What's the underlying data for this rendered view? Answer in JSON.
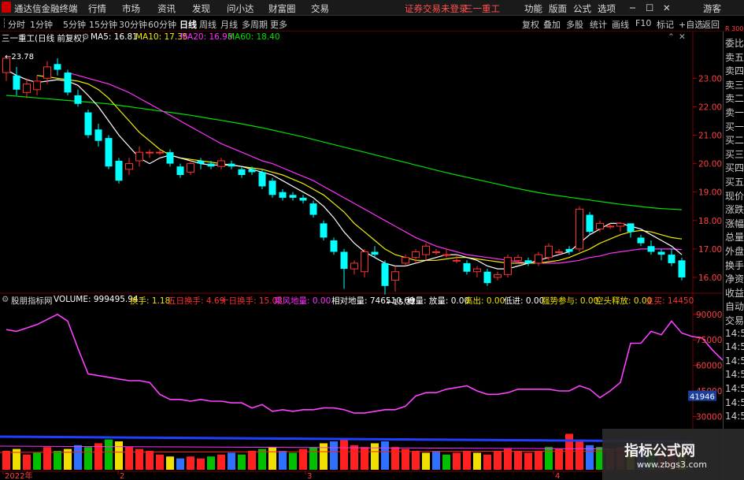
{
  "app": {
    "title": "通达信金融终端",
    "menus": [
      "行情",
      "市场",
      "资讯",
      "发现",
      "问小达",
      "财富圈",
      "交易"
    ],
    "login_notice": "证券交易未登录",
    "stock_title": "三一重工",
    "right_menus": [
      "功能",
      "版面",
      "公式",
      "选项"
    ],
    "guest": "游客"
  },
  "toolbar": {
    "periods": [
      "分时",
      "1分钟",
      "5分钟",
      "15分钟",
      "30分钟",
      "60分钟",
      "日线",
      "周线",
      "月线",
      "多周期",
      "更多"
    ],
    "active_period": "日线",
    "actions": [
      "复权",
      "叠加",
      "多股",
      "统计",
      "画线",
      "F10",
      "标记",
      "+自选",
      "返回"
    ]
  },
  "chart_header": {
    "name": "三一重工(日线 前复权)",
    "ma5": "MA5: 16.81",
    "ma10": "MA10: 17.35",
    "ma20": "MA20: 16.98",
    "ma60": "MA60: 18.40"
  },
  "indicator_header": {
    "name": "股朋指标网",
    "volume": "VOLUME: 999495.94",
    "items": [
      {
        "t": "换手: 1.18",
        "c": "#f0e000"
      },
      {
        "t": "五日换手: 4.69",
        "c": "#ff3030"
      },
      {
        "t": "十日换手: 15.03",
        "c": "#ff3030"
      },
      {
        "t": "乘风地量: 0.00",
        "c": "#ff30ff"
      },
      {
        "t": "相对地量: 746510.69",
        "c": "#ffffff"
      },
      {
        "t": "地量: 放量: 0.00",
        "c": "#ffffff"
      },
      {
        "t": "高出: 0.00",
        "c": "#f0e000"
      },
      {
        "t": "低进: 0.00",
        "c": "#ffffff"
      },
      {
        "t": "强势参与: 0.00",
        "c": "#f0e000"
      },
      {
        "t": "空头释放: 0.00",
        "c": "#f0e000"
      },
      {
        "t": "主买: 14450",
        "c": "#ff3030"
      }
    ]
  },
  "right_panel": [
    "委比",
    "卖五",
    "卖四",
    "卖三",
    "卖二",
    "卖一",
    "买一",
    "买二",
    "买三",
    "买四",
    "买五",
    "现价",
    "涨跌",
    "涨幅",
    "总量",
    "外盘",
    "换手",
    "净资",
    "收益",
    "自动",
    "交易",
    "14:56",
    "14:56",
    "14:56",
    "14:56",
    "14:56",
    "14:56",
    "14:56"
  ],
  "right_panel_top": "R 300",
  "watermark": {
    "main": "指标公式网",
    "sub": "www.zbgs3.com"
  },
  "chart_data": {
    "type": "candlestick",
    "price_axis": {
      "ticks": [
        "23.00",
        "22.00",
        "21.00",
        "20.00",
        "19.00",
        "18.00",
        "17.00",
        "16.00"
      ],
      "range": [
        15.5,
        24.2
      ]
    },
    "indicator_axis": {
      "ticks": [
        "90000",
        "75000",
        "60000",
        "45000",
        "30000"
      ],
      "current": "41946"
    },
    "x_labels": [
      "2022年",
      "2",
      "3",
      "4"
    ],
    "annotations": {
      "high": "23.78",
      "low": "15.37"
    },
    "colors": {
      "up": "#ff3030",
      "down": "#00ffff",
      "ma5": "#ffffff",
      "ma10": "#f0f000",
      "ma20": "#ff30ff",
      "ma60": "#00e000",
      "ind": "#ff40ff"
    },
    "candles": [
      [
        23.2,
        23.7,
        23.78,
        22.9
      ],
      [
        23.1,
        22.6,
        23.4,
        22.4
      ],
      [
        22.5,
        22.8,
        23.0,
        22.3
      ],
      [
        22.6,
        22.9,
        23.1,
        22.4
      ],
      [
        23.0,
        23.4,
        23.6,
        22.8
      ],
      [
        23.5,
        23.3,
        23.7,
        23.1
      ],
      [
        23.2,
        22.5,
        23.3,
        22.4
      ],
      [
        22.4,
        22.1,
        22.6,
        22.0
      ],
      [
        21.8,
        21.0,
        21.9,
        20.9
      ],
      [
        21.2,
        20.8,
        21.4,
        20.6
      ],
      [
        20.9,
        19.9,
        21.0,
        19.8
      ],
      [
        20.1,
        19.4,
        20.2,
        19.3
      ],
      [
        19.8,
        20.0,
        20.2,
        19.6
      ],
      [
        20.1,
        20.4,
        20.6,
        19.9
      ],
      [
        20.4,
        20.4,
        20.5,
        20.2
      ],
      [
        20.4,
        20.4,
        20.5,
        20.3
      ],
      [
        20.4,
        20.0,
        20.5,
        19.9
      ],
      [
        19.9,
        19.6,
        20.0,
        19.5
      ],
      [
        19.7,
        20.0,
        20.1,
        19.6
      ],
      [
        20.1,
        20.0,
        20.2,
        19.8
      ],
      [
        20.0,
        19.9,
        20.1,
        19.8
      ],
      [
        19.9,
        20.1,
        20.2,
        19.8
      ],
      [
        20.0,
        19.9,
        20.1,
        19.8
      ],
      [
        19.8,
        19.6,
        19.9,
        19.5
      ],
      [
        19.8,
        19.7,
        19.9,
        19.6
      ],
      [
        19.7,
        19.2,
        19.8,
        19.1
      ],
      [
        19.4,
        18.9,
        19.5,
        18.8
      ],
      [
        19.0,
        18.8,
        19.1,
        18.7
      ],
      [
        18.9,
        18.8,
        19.0,
        18.7
      ],
      [
        18.8,
        18.7,
        18.9,
        18.6
      ],
      [
        18.6,
        18.2,
        18.7,
        18.1
      ],
      [
        17.9,
        17.4,
        18.0,
        17.3
      ],
      [
        17.3,
        16.9,
        17.4,
        16.8
      ],
      [
        16.9,
        16.3,
        17.0,
        15.6
      ],
      [
        16.3,
        16.5,
        16.6,
        16.1
      ],
      [
        16.2,
        16.9,
        17.0,
        16.0
      ],
      [
        16.9,
        16.8,
        17.1,
        16.7
      ],
      [
        16.5,
        15.7,
        16.6,
        15.4
      ],
      [
        15.9,
        16.2,
        16.4,
        15.5
      ],
      [
        16.5,
        16.7,
        16.8,
        16.4
      ],
      [
        16.7,
        16.9,
        17.0,
        16.5
      ],
      [
        16.8,
        17.1,
        17.2,
        16.6
      ],
      [
        16.9,
        16.9,
        17.0,
        16.8
      ],
      [
        16.8,
        16.8,
        17.0,
        16.7
      ],
      [
        16.6,
        16.6,
        16.8,
        16.5
      ],
      [
        16.5,
        16.2,
        16.6,
        16.1
      ],
      [
        16.2,
        16.3,
        16.4,
        16.0
      ],
      [
        16.2,
        15.8,
        16.3,
        15.7
      ],
      [
        16.0,
        16.1,
        16.2,
        15.9
      ],
      [
        16.1,
        16.7,
        16.8,
        16.0
      ],
      [
        16.6,
        16.7,
        16.8,
        16.5
      ],
      [
        16.6,
        16.5,
        16.7,
        16.4
      ],
      [
        16.5,
        16.8,
        16.9,
        16.4
      ],
      [
        16.7,
        17.1,
        17.2,
        16.6
      ],
      [
        16.9,
        16.9,
        17.0,
        16.8
      ],
      [
        17.0,
        16.9,
        17.1,
        16.8
      ],
      [
        17.0,
        18.4,
        18.5,
        16.9
      ],
      [
        18.2,
        17.6,
        18.3,
        17.5
      ],
      [
        17.7,
        17.9,
        18.0,
        17.6
      ],
      [
        17.8,
        17.8,
        17.9,
        17.7
      ],
      [
        17.8,
        17.9,
        17.95,
        17.6
      ],
      [
        17.9,
        17.6,
        17.9,
        17.4
      ],
      [
        17.4,
        17.2,
        17.5,
        17.1
      ],
      [
        17.1,
        16.9,
        17.3,
        16.8
      ],
      [
        16.9,
        16.8,
        17.0,
        16.6
      ],
      [
        16.8,
        16.5,
        17.0,
        16.4
      ],
      [
        16.6,
        16.0,
        16.7,
        15.9
      ]
    ],
    "ma5": [
      23.3,
      23.1,
      22.95,
      22.85,
      22.9,
      22.95,
      22.9,
      22.75,
      22.4,
      22.0,
      21.5,
      21.0,
      20.6,
      20.2,
      20.0,
      20.2,
      20.3,
      20.2,
      20.1,
      20.0,
      19.95,
      19.95,
      19.95,
      19.9,
      19.8,
      19.7,
      19.6,
      19.4,
      19.2,
      19.0,
      18.8,
      18.5,
      18.1,
      17.6,
      17.2,
      16.9,
      16.7,
      16.5,
      16.4,
      16.4,
      16.5,
      16.6,
      16.7,
      16.8,
      16.8,
      16.7,
      16.6,
      16.4,
      16.3,
      16.3,
      16.4,
      16.5,
      16.6,
      16.7,
      16.8,
      16.9,
      17.2,
      17.5,
      17.7,
      17.9,
      17.9,
      17.8,
      17.7,
      17.5,
      17.3,
      17.1,
      16.8
    ],
    "ma10": [
      null,
      null,
      null,
      23.1,
      23.05,
      23.0,
      22.95,
      22.9,
      22.8,
      22.6,
      22.3,
      21.9,
      21.5,
      21.1,
      20.8,
      20.5,
      20.3,
      20.2,
      20.15,
      20.1,
      20.05,
      20.0,
      19.95,
      19.9,
      19.85,
      19.8,
      19.7,
      19.6,
      19.45,
      19.3,
      19.1,
      18.9,
      18.6,
      18.3,
      17.9,
      17.6,
      17.3,
      17.0,
      16.8,
      16.7,
      16.6,
      16.6,
      16.6,
      16.65,
      16.7,
      16.7,
      16.65,
      16.6,
      16.55,
      16.5,
      16.5,
      16.5,
      16.5,
      16.55,
      16.6,
      16.7,
      16.85,
      17.0,
      17.2,
      17.35,
      17.5,
      17.6,
      17.65,
      17.6,
      17.5,
      17.4,
      17.35
    ],
    "ma20": [
      null,
      null,
      null,
      null,
      null,
      null,
      23.2,
      23.1,
      23.0,
      22.9,
      22.8,
      22.65,
      22.5,
      22.3,
      22.1,
      21.9,
      21.7,
      21.5,
      21.3,
      21.1,
      20.9,
      20.7,
      20.55,
      20.4,
      20.25,
      20.1,
      20.0,
      19.85,
      19.7,
      19.55,
      19.4,
      19.2,
      19.0,
      18.8,
      18.6,
      18.4,
      18.2,
      18.0,
      17.8,
      17.6,
      17.4,
      17.25,
      17.1,
      17.0,
      16.9,
      16.8,
      16.75,
      16.7,
      16.65,
      16.6,
      16.55,
      16.5,
      16.5,
      16.5,
      16.5,
      16.55,
      16.6,
      16.7,
      16.75,
      16.85,
      16.9,
      16.95,
      17.0,
      17.0,
      17.0,
      17.0,
      16.98
    ],
    "ma60": [
      22.4,
      22.37,
      22.34,
      22.31,
      22.28,
      22.25,
      22.22,
      22.19,
      22.16,
      22.13,
      22.1,
      22.05,
      22.0,
      21.95,
      21.9,
      21.85,
      21.8,
      21.75,
      21.7,
      21.64,
      21.58,
      21.52,
      21.46,
      21.4,
      21.33,
      21.26,
      21.18,
      21.1,
      21.02,
      20.94,
      20.85,
      20.76,
      20.67,
      20.58,
      20.49,
      20.4,
      20.31,
      20.22,
      20.13,
      20.04,
      19.95,
      19.86,
      19.77,
      19.68,
      19.6,
      19.52,
      19.44,
      19.36,
      19.28,
      19.2,
      19.12,
      19.05,
      18.98,
      18.92,
      18.87,
      18.82,
      18.77,
      18.72,
      18.67,
      18.62,
      18.57,
      18.53,
      18.49,
      18.45,
      18.42,
      18.4,
      18.38
    ],
    "ind": [
      81000,
      80000,
      82000,
      84000,
      87000,
      90000,
      86000,
      70000,
      55000,
      54000,
      53000,
      52000,
      51000,
      51000,
      50000,
      43000,
      40000,
      40000,
      39000,
      40000,
      39000,
      39000,
      38000,
      38000,
      35000,
      37000,
      33000,
      34000,
      33000,
      34000,
      34000,
      35000,
      35000,
      34000,
      32000,
      32000,
      33000,
      34000,
      34000,
      36000,
      42000,
      44000,
      44000,
      46000,
      47000,
      48000,
      45000,
      43000,
      43000,
      44000,
      46000,
      46000,
      46000,
      46000,
      45000,
      45000,
      48000,
      46000,
      41000,
      45000,
      50000,
      73000,
      73000,
      80000,
      78000,
      86000,
      79000,
      77000,
      76000,
      69000,
      63000
    ],
    "vol_colors": [
      "u",
      "d",
      "u",
      "d",
      "u",
      "d",
      "d",
      "d",
      "d",
      "d",
      "d",
      "d",
      "u",
      "u",
      "d",
      "u",
      "d",
      "d",
      "u",
      "d",
      "d",
      "u",
      "d",
      "d",
      "d",
      "d",
      "d",
      "d",
      "d",
      "d",
      "d",
      "d",
      "d",
      "u",
      "u",
      "u",
      "d",
      "d",
      "u",
      "u",
      "u",
      "d",
      "d",
      "d",
      "d",
      "u",
      "d",
      "u",
      "u",
      "d",
      "u",
      "u",
      "u",
      "d",
      "d",
      "u",
      "u",
      "d",
      "d",
      "d",
      "u",
      "d",
      "d",
      "d",
      "d",
      "u",
      "d"
    ],
    "vol": [
      0.5,
      0.55,
      0.4,
      0.45,
      0.6,
      0.5,
      0.55,
      0.65,
      0.6,
      0.7,
      0.8,
      0.75,
      0.6,
      0.55,
      0.5,
      0.4,
      0.35,
      0.3,
      0.35,
      0.3,
      0.35,
      0.4,
      0.45,
      0.4,
      0.5,
      0.55,
      0.6,
      0.5,
      0.45,
      0.55,
      0.6,
      0.7,
      0.75,
      0.8,
      0.65,
      0.6,
      0.7,
      0.75,
      0.6,
      0.55,
      0.5,
      0.45,
      0.5,
      0.4,
      0.45,
      0.5,
      0.45,
      0.4,
      0.5,
      0.55,
      0.5,
      0.45,
      0.5,
      0.6,
      0.55,
      0.95,
      0.8,
      0.65,
      0.6,
      0.55,
      0.6,
      0.5,
      0.55,
      0.5,
      0.45,
      0.6,
      0.5
    ]
  }
}
